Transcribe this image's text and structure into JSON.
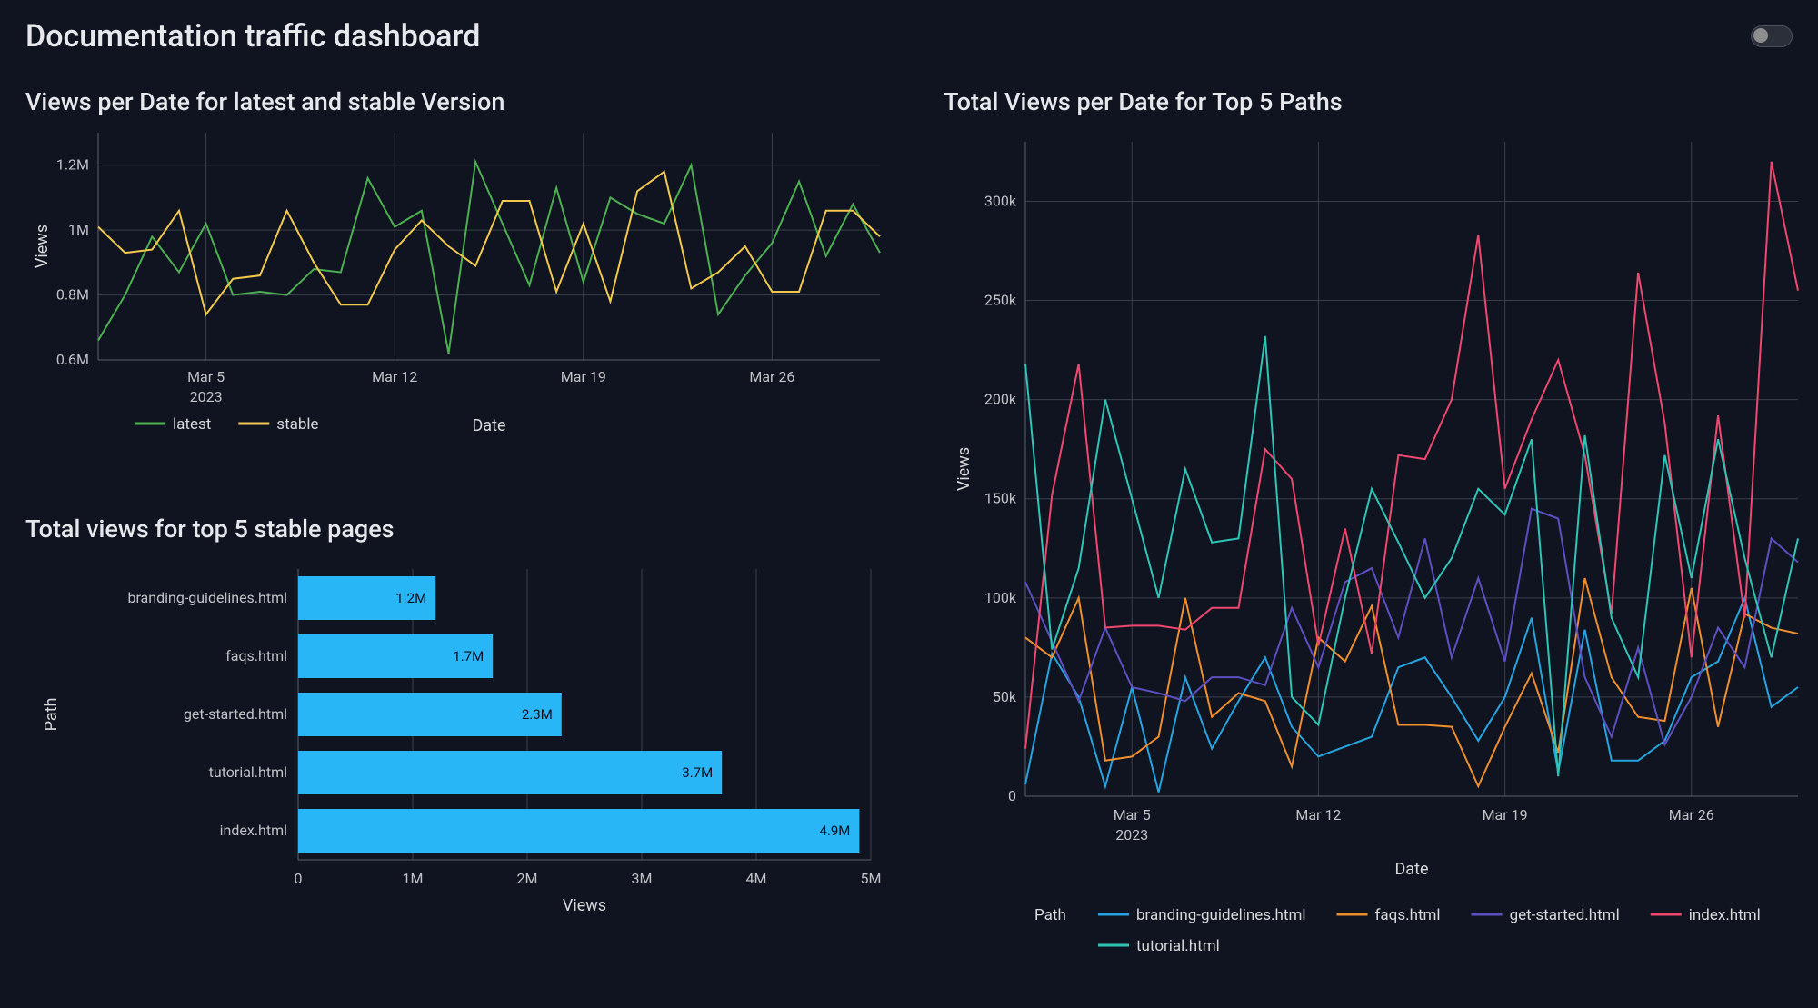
{
  "header": {
    "title": "Documentation traffic dashboard"
  },
  "chart_data": [
    {
      "id": "versions",
      "type": "line",
      "title": "Views per Date for latest and stable Version",
      "xlabel": "Date",
      "ylabel": "Views",
      "x_ticks": [
        "Mar 5",
        "Mar 12",
        "Mar 19",
        "Mar 26"
      ],
      "x_tick_sub": "2023",
      "y_ticks": [
        "0.6M",
        "0.8M",
        "1M",
        "1.2M"
      ],
      "ylim": [
        600000,
        1300000
      ],
      "x": [
        1,
        2,
        3,
        4,
        5,
        6,
        7,
        8,
        9,
        10,
        11,
        12,
        13,
        14,
        15,
        16,
        17,
        18,
        19,
        20,
        21,
        22,
        23,
        24,
        25,
        26,
        27,
        28,
        29,
        30
      ],
      "series": [
        {
          "name": "latest",
          "color": "#4caf50",
          "values": [
            660000,
            800000,
            980000,
            870000,
            1020000,
            800000,
            810000,
            800000,
            880000,
            870000,
            1160000,
            1010000,
            1060000,
            620000,
            1210000,
            1020000,
            830000,
            1130000,
            840000,
            1100000,
            1050000,
            1020000,
            1200000,
            740000,
            860000,
            960000,
            1150000,
            920000,
            1080000,
            930000
          ]
        },
        {
          "name": "stable",
          "color": "#f2c94c",
          "values": [
            1010000,
            930000,
            940000,
            1060000,
            740000,
            850000,
            860000,
            1060000,
            900000,
            770000,
            770000,
            940000,
            1030000,
            950000,
            890000,
            1090000,
            1090000,
            810000,
            1020000,
            780000,
            1120000,
            1180000,
            820000,
            870000,
            950000,
            810000,
            810000,
            1060000,
            1060000,
            980000
          ]
        }
      ],
      "legend": [
        "latest",
        "stable"
      ]
    },
    {
      "id": "top5bars",
      "type": "bar",
      "title": "Total views for top 5 stable pages",
      "xlabel": "Views",
      "ylabel": "Path",
      "categories": [
        "branding-guidelines.html",
        "faqs.html",
        "get-started.html",
        "tutorial.html",
        "index.html"
      ],
      "values": [
        1200000,
        1700000,
        2300000,
        3700000,
        4900000
      ],
      "value_labels": [
        "1.2M",
        "1.7M",
        "2.3M",
        "3.7M",
        "4.9M"
      ],
      "x_ticks": [
        "0",
        "1M",
        "2M",
        "3M",
        "4M",
        "5M"
      ],
      "xlim": [
        0,
        5000000
      ],
      "bar_color": "#29b6f6"
    },
    {
      "id": "top5paths",
      "type": "line",
      "title": "Total Views per Date for Top 5 Paths",
      "xlabel": "Date",
      "ylabel": "Views",
      "x_ticks": [
        "Mar 5",
        "Mar 12",
        "Mar 19",
        "Mar 26"
      ],
      "x_tick_sub": "2023",
      "y_ticks": [
        "0",
        "50k",
        "100k",
        "150k",
        "200k",
        "250k",
        "300k"
      ],
      "ylim": [
        0,
        330000
      ],
      "x": [
        1,
        2,
        3,
        4,
        5,
        6,
        7,
        8,
        9,
        10,
        11,
        12,
        13,
        14,
        15,
        16,
        17,
        18,
        19,
        20,
        21,
        22,
        23,
        24,
        25,
        26,
        27,
        28,
        29,
        30
      ],
      "legend_title": "Path",
      "series": [
        {
          "name": "branding-guidelines.html",
          "color": "#26a4df",
          "values": [
            6000,
            72000,
            50000,
            5000,
            55000,
            2000,
            60000,
            24000,
            48000,
            70000,
            35000,
            20000,
            25000,
            30000,
            65000,
            70000,
            50000,
            28000,
            50000,
            90000,
            12000,
            84000,
            18000,
            18000,
            28000,
            60000,
            68000,
            100000,
            45000,
            55000
          ]
        },
        {
          "name": "faqs.html",
          "color": "#ef8e2c",
          "values": [
            80000,
            70000,
            100000,
            18000,
            20000,
            30000,
            100000,
            40000,
            52000,
            48000,
            15000,
            80000,
            68000,
            96000,
            36000,
            36000,
            35000,
            5000,
            35000,
            62000,
            22000,
            110000,
            60000,
            40000,
            38000,
            105000,
            35000,
            92000,
            85000,
            82000
          ]
        },
        {
          "name": "get-started.html",
          "color": "#5e4fc1",
          "values": [
            108000,
            78000,
            48000,
            85000,
            55000,
            52000,
            48000,
            60000,
            60000,
            56000,
            95000,
            65000,
            108000,
            115000,
            80000,
            130000,
            70000,
            110000,
            68000,
            145000,
            140000,
            60000,
            30000,
            75000,
            26000,
            50000,
            85000,
            65000,
            130000,
            118000
          ]
        },
        {
          "name": "index.html",
          "color": "#ef476f",
          "values": [
            24000,
            152000,
            218000,
            85000,
            86000,
            86000,
            84000,
            95000,
            95000,
            175000,
            160000,
            76000,
            135000,
            72000,
            172000,
            170000,
            200000,
            283000,
            155000,
            190000,
            220000,
            172000,
            92000,
            264000,
            188000,
            70000,
            192000,
            90000,
            320000,
            255000
          ]
        },
        {
          "name": "tutorial.html",
          "color": "#2ec4b6",
          "values": [
            218000,
            74000,
            115000,
            200000,
            150000,
            100000,
            165000,
            128000,
            130000,
            232000,
            50000,
            36000,
            100000,
            155000,
            128000,
            100000,
            120000,
            155000,
            142000,
            180000,
            10000,
            182000,
            90000,
            60000,
            172000,
            110000,
            180000,
            120000,
            70000,
            130000
          ]
        }
      ]
    }
  ]
}
